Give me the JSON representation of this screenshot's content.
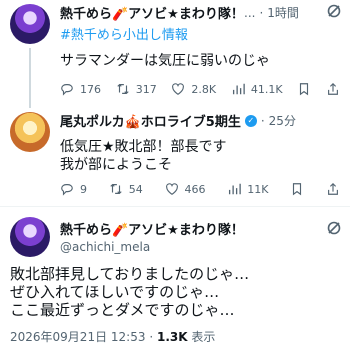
{
  "tweets": [
    {
      "name": "熱千めら🧨アソビ★まわり隊！",
      "ellipsis": "...",
      "time": "1時間",
      "hashtag": "#熱千めら小出し情報",
      "text": "サラマンダーは気圧に弱いのじゃ",
      "stats": {
        "replies": "176",
        "retweets": "317",
        "likes": "2.8K",
        "views": "41.1K"
      }
    },
    {
      "name": "尾丸ポルカ🎪ホロライブ5期生",
      "time": "25分",
      "text_line1": "低気圧★敗北部！部長です",
      "text_line2": "我が部にようこそ",
      "stats": {
        "replies": "9",
        "retweets": "54",
        "likes": "466",
        "views": "11K"
      }
    },
    {
      "name": "熱千めら🧨アソビ★まわり隊！",
      "handle": "@achichi_mela",
      "text_line1": "敗北部拝見しておりましたのじゃ…",
      "text_line2": "ぜひ入れてほしいですのじゃ…",
      "text_line3": "ここ最近ずっとダメですのじゃ…",
      "footer_datetime": "2026年09月21日 12:53",
      "footer_sep": "·",
      "footer_views": "1.3K",
      "footer_views_label": "表示"
    }
  ],
  "colors": {
    "accent": "#1d9bf0",
    "muted": "#536471"
  }
}
